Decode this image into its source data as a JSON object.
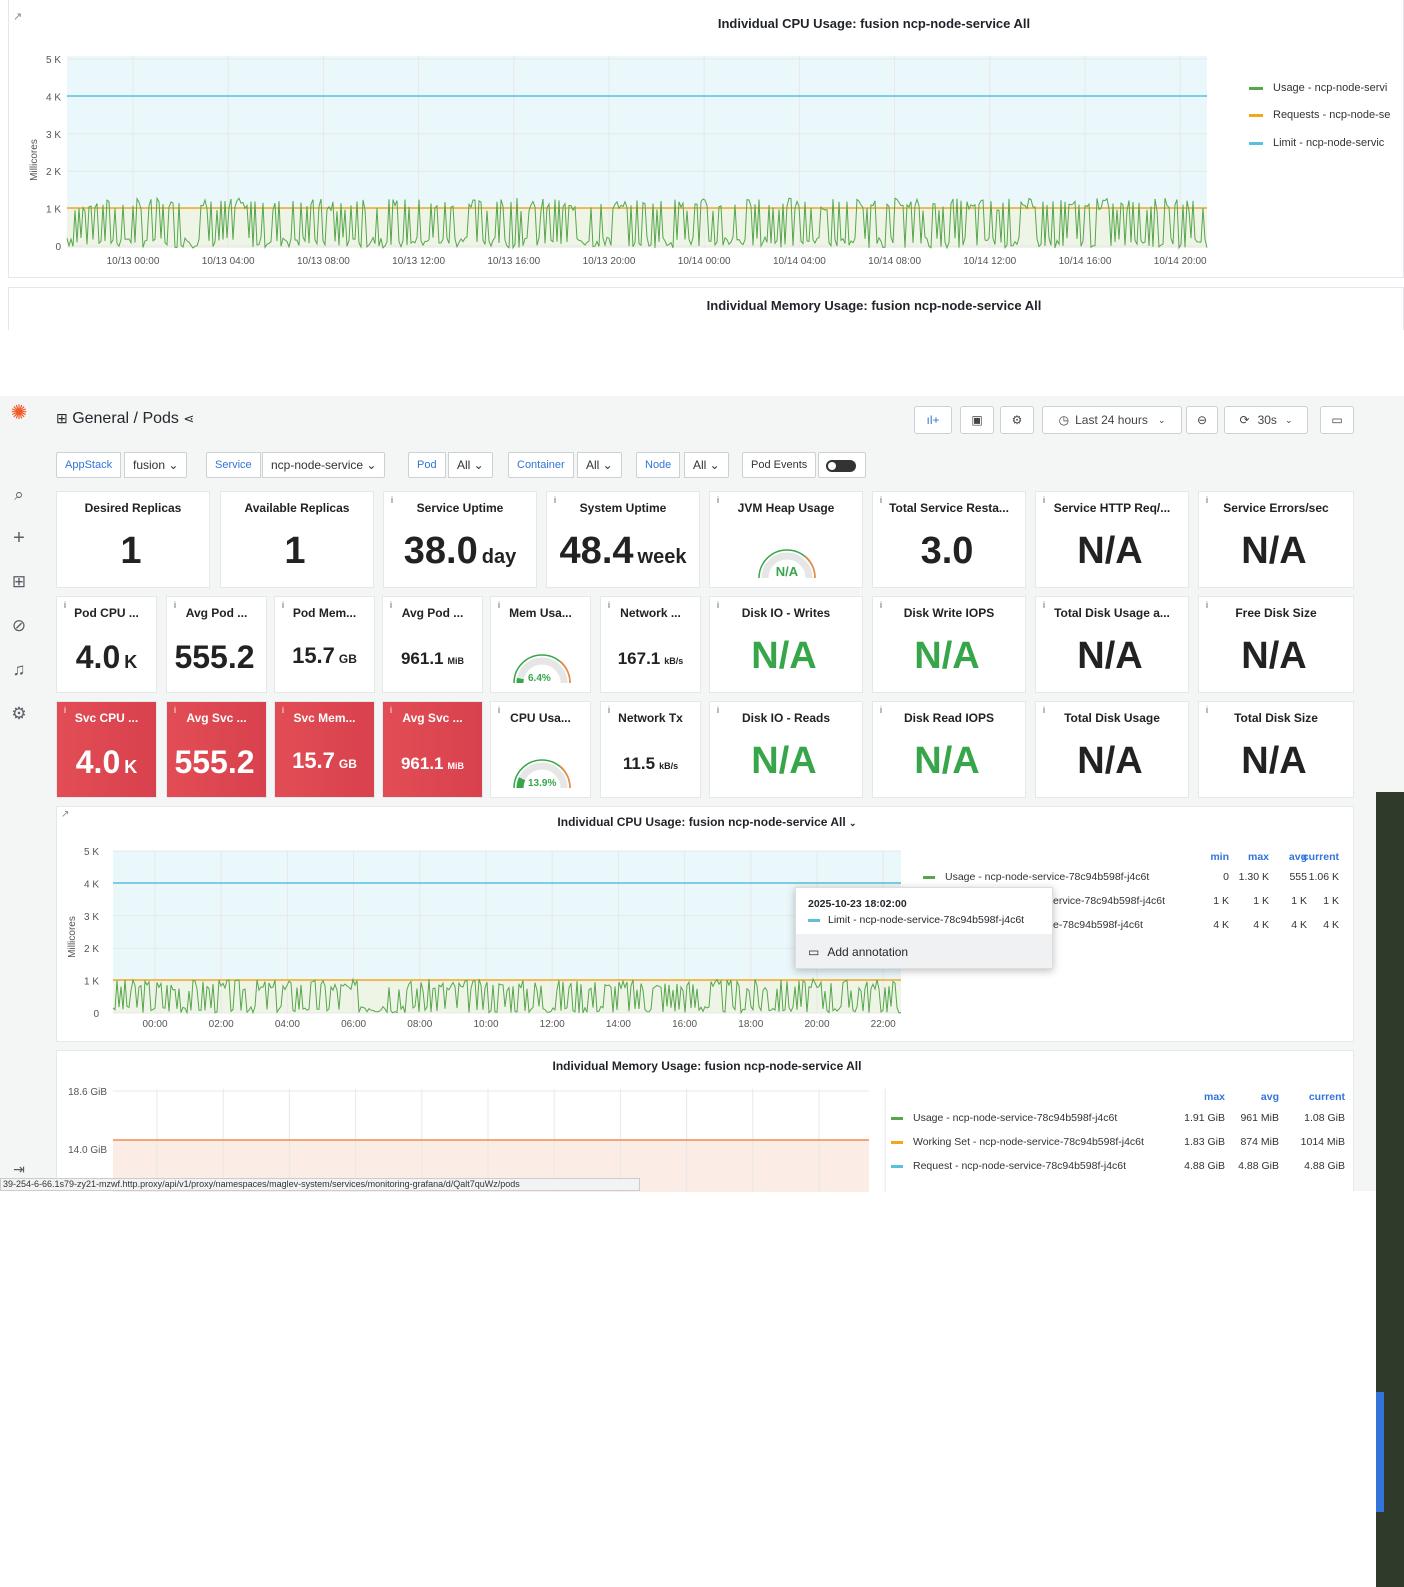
{
  "top_panel": {
    "title": "Individual CPU Usage: fusion ncp-node-service All",
    "ylabel": "Millicores",
    "yticks": [
      "5 K",
      "4 K",
      "3 K",
      "2 K",
      "1 K",
      "0"
    ],
    "xticks": [
      "10/13 00:00",
      "10/13 04:00",
      "10/13 08:00",
      "10/13 12:00",
      "10/13 16:00",
      "10/13 20:00",
      "10/14 00:00",
      "10/14 04:00",
      "10/14 08:00",
      "10/14 12:00",
      "10/14 16:00",
      "10/14 20:00"
    ],
    "legend": [
      {
        "label": "Usage - ncp-node-servi",
        "color": "#56a64b"
      },
      {
        "label": "Requests - ncp-node-se",
        "color": "#f2a81d"
      },
      {
        "label": "Limit - ncp-node-servic",
        "color": "#5bc0de"
      }
    ],
    "mem_title": "Individual Memory Usage: fusion ncp-node-service All"
  },
  "header": {
    "breadcrumb": "General / Pods",
    "time_range": "Last 24 hours",
    "refresh": "30s"
  },
  "variables": {
    "appstack_label": "AppStack",
    "appstack_value": "fusion",
    "service_label": "Service",
    "service_value": "ncp-node-service",
    "pod_label": "Pod",
    "pod_value": "All",
    "container_label": "Container",
    "container_value": "All",
    "node_label": "Node",
    "node_value": "All",
    "pod_events_label": "Pod Events"
  },
  "stats_row1": [
    {
      "title": "Desired Replicas",
      "value": "1",
      "unit": ""
    },
    {
      "title": "Available Replicas",
      "value": "1",
      "unit": ""
    },
    {
      "title": "Service Uptime",
      "value": "38.0",
      "unit": "day"
    },
    {
      "title": "System Uptime",
      "value": "48.4",
      "unit": "week"
    },
    {
      "title": "JVM Heap Usage",
      "value": "N/A",
      "unit": ""
    },
    {
      "title": "Total Service Resta...",
      "value": "3.0",
      "unit": ""
    },
    {
      "title": "Service HTTP Req/...",
      "value": "N/A",
      "unit": ""
    },
    {
      "title": "Service Errors/sec",
      "value": "N/A",
      "unit": ""
    }
  ],
  "stats_row2": [
    {
      "title": "Pod CPU ...",
      "value": "4.0",
      "unit": "K"
    },
    {
      "title": "Avg Pod ...",
      "value": "555.2",
      "unit": ""
    },
    {
      "title": "Pod Mem...",
      "value": "15.7",
      "unit": "GB"
    },
    {
      "title": "Avg Pod ...",
      "value": "961.1",
      "unit": "MiB"
    },
    {
      "title": "Mem Usa...",
      "value": "6.4%",
      "unit": ""
    },
    {
      "title": "Network ...",
      "value": "167.1",
      "unit": "kB/s"
    },
    {
      "title": "Disk IO - Writes",
      "value": "N/A",
      "unit": ""
    },
    {
      "title": "Disk Write IOPS",
      "value": "N/A",
      "unit": ""
    },
    {
      "title": "Total Disk Usage a...",
      "value": "N/A",
      "unit": ""
    },
    {
      "title": "Free Disk Size",
      "value": "N/A",
      "unit": ""
    }
  ],
  "stats_row3": [
    {
      "title": "Svc CPU ...",
      "value": "4.0",
      "unit": "K"
    },
    {
      "title": "Avg Svc ...",
      "value": "555.2",
      "unit": ""
    },
    {
      "title": "Svc Mem...",
      "value": "15.7",
      "unit": "GB"
    },
    {
      "title": "Avg Svc ...",
      "value": "961.1",
      "unit": "MiB"
    },
    {
      "title": "CPU Usa...",
      "value": "13.9%",
      "unit": ""
    },
    {
      "title": "Network Tx",
      "value": "11.5",
      "unit": "kB/s"
    },
    {
      "title": "Disk IO - Reads",
      "value": "N/A",
      "unit": ""
    },
    {
      "title": "Disk Read IOPS",
      "value": "N/A",
      "unit": ""
    },
    {
      "title": "Total Disk Usage",
      "value": "N/A",
      "unit": ""
    },
    {
      "title": "Total Disk Size",
      "value": "N/A",
      "unit": ""
    }
  ],
  "gauges": {
    "mem_pct": 0.064,
    "cpu_pct": 0.139
  },
  "cpu_panel": {
    "title": "Individual CPU Usage: fusion ncp-node-service All",
    "ylabel": "Millicores",
    "yticks": [
      "5 K",
      "4 K",
      "3 K",
      "2 K",
      "1 K",
      "0"
    ],
    "xticks": [
      "00:00",
      "02:00",
      "04:00",
      "06:00",
      "08:00",
      "10:00",
      "12:00",
      "14:00",
      "16:00",
      "18:00",
      "20:00",
      "22:00"
    ],
    "headers": [
      "min",
      "max",
      "avg",
      "current"
    ],
    "rows": [
      {
        "label": "Usage - ncp-node-service-78c94b598f-j4c6t",
        "color": "#56a64b",
        "min": "0",
        "max": "1.30 K",
        "avg": "555",
        "current": "1.06 K"
      },
      {
        "label": "ervice-78c94b598f-j4c6t",
        "color": "#f2a81d",
        "min": "1 K",
        "max": "1 K",
        "avg": "1 K",
        "current": "1 K"
      },
      {
        "label": "e-78c94b598f-j4c6t",
        "color": "#5bc0de",
        "min": "4 K",
        "max": "4 K",
        "avg": "4 K",
        "current": "4 K"
      }
    ],
    "tooltip_time": "2025-10-23 18:02:00",
    "tooltip_series": "Limit - ncp-node-service-78c94b598f-j4c6t",
    "add_annotation": "Add annotation"
  },
  "mem_panel": {
    "title": "Individual Memory Usage: fusion ncp-node-service All",
    "yticks": [
      "18.6 GiB",
      "14.0 GiB"
    ],
    "headers": [
      "max",
      "avg",
      "current"
    ],
    "rows": [
      {
        "label": "Usage - ncp-node-service-78c94b598f-j4c6t",
        "color": "#56a64b",
        "max": "1.91 GiB",
        "avg": "961 MiB",
        "current": "1.08 GiB"
      },
      {
        "label": "Working Set - ncp-node-service-78c94b598f-j4c6t",
        "color": "#f2a81d",
        "max": "1.83 GiB",
        "avg": "874 MiB",
        "current": "1014 MiB"
      },
      {
        "label": "Request - ncp-node-service-78c94b598f-j4c6t",
        "color": "#5bc0de",
        "max": "4.88 GiB",
        "avg": "4.88 GiB",
        "current": "4.88 GiB"
      }
    ]
  },
  "status_url": "39-254-6-66.1s79-zy21-mzwf.http.proxy/api/v1/proxy/namespaces/maglev-system/services/monitoring-grafana/d/Qalt7quWz/pods"
}
